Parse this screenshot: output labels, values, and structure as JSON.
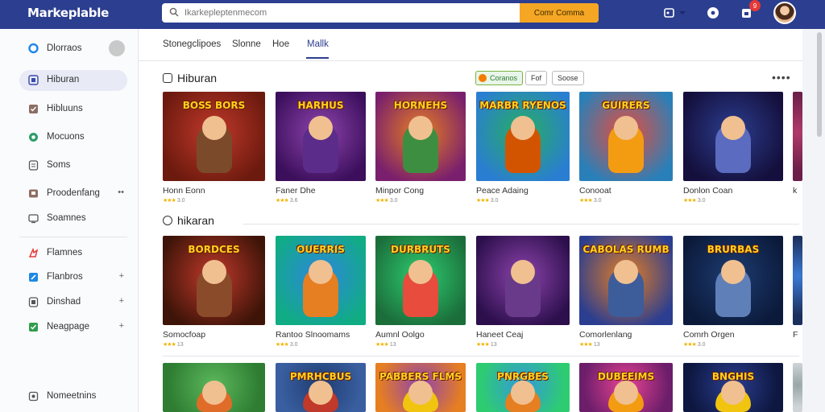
{
  "header": {
    "logo": "Markeplable",
    "search_placeholder": "Ikarkepleptenmecom",
    "search_button": "Comr Comma",
    "notification_count": "9"
  },
  "sidebar": {
    "top_item": "Dlorraos",
    "items": [
      {
        "label": "Hiburan",
        "active": true,
        "extra": ""
      },
      {
        "label": "Hibluuns",
        "active": false,
        "extra": ""
      },
      {
        "label": "Mocuons",
        "active": false,
        "extra": ""
      },
      {
        "label": "Soms",
        "active": false,
        "extra": ""
      },
      {
        "label": "Proodenfang",
        "active": false,
        "extra": "••"
      },
      {
        "label": "Soamnes",
        "active": false,
        "extra": ""
      }
    ],
    "items2": [
      {
        "label": "Flamnes",
        "extra": ""
      },
      {
        "label": "Flanbros",
        "extra": "+"
      },
      {
        "label": "Dinshad",
        "extra": "+"
      },
      {
        "label": "Neagpage",
        "extra": "+"
      }
    ],
    "bottom_item": "Nomeetnins"
  },
  "tabs": [
    {
      "label": "Stonegclipoes"
    },
    {
      "label": "Slonne"
    },
    {
      "label": "Hoe"
    },
    {
      "label": "Mallk"
    }
  ],
  "sections": [
    {
      "title": "Hiburan",
      "chips": [
        "Coranos",
        "Fof",
        "Soose"
      ],
      "cards": [
        {
          "thumb_title": "BOSS BORS",
          "name": "Honn Eonn",
          "rating": "3.0"
        },
        {
          "thumb_title": "HARHUS",
          "name": "Faner Dhe",
          "rating": "3.6"
        },
        {
          "thumb_title": "HORNEHS",
          "name": "Minpor Cong",
          "rating": "3.0"
        },
        {
          "thumb_title": "MARBR RYENOS",
          "name": "Peace Adaing",
          "rating": "3.0"
        },
        {
          "thumb_title": "GUIRERS",
          "name": "Conooat",
          "rating": "3.0"
        },
        {
          "thumb_title": "",
          "name": "Donlon Coan",
          "rating": "3.0"
        },
        {
          "thumb_title": "",
          "name": "k",
          "rating": ""
        }
      ]
    },
    {
      "title": "hikaran",
      "chips": [],
      "cards": [
        {
          "thumb_title": "BORDCES",
          "name": "Somocfoap",
          "rating": "13"
        },
        {
          "thumb_title": "OUERRIS",
          "name": "Rantoo Slnoomams",
          "rating": "3.0"
        },
        {
          "thumb_title": "DURBRUTS",
          "name": "Aumnl Oolgo",
          "rating": "13"
        },
        {
          "thumb_title": "",
          "name": "Haneet Ceaj",
          "rating": "13"
        },
        {
          "thumb_title": "CABOLAS RUMB",
          "name": "Comorlenlang",
          "rating": "13"
        },
        {
          "thumb_title": "BRURBAS",
          "name": "Comrh Orgen",
          "rating": "3.0"
        },
        {
          "thumb_title": "",
          "name": "F",
          "rating": ""
        }
      ]
    },
    {
      "title": "",
      "chips": [],
      "cards": [
        {
          "thumb_title": "",
          "name": "",
          "rating": ""
        },
        {
          "thumb_title": "PMRHCBUS",
          "name": "",
          "rating": ""
        },
        {
          "thumb_title": "PABBERS FLMS",
          "name": "",
          "rating": ""
        },
        {
          "thumb_title": "PNRGBES",
          "name": "",
          "rating": ""
        },
        {
          "thumb_title": "DUBEEIMS",
          "name": "",
          "rating": ""
        },
        {
          "thumb_title": "BNGHIS",
          "name": "",
          "rating": ""
        },
        {
          "thumb_title": "",
          "name": "",
          "rating": ""
        }
      ]
    }
  ],
  "colors": {
    "brand": "#2c3e8f",
    "accent": "#f5a623",
    "star": "#f2b300"
  }
}
